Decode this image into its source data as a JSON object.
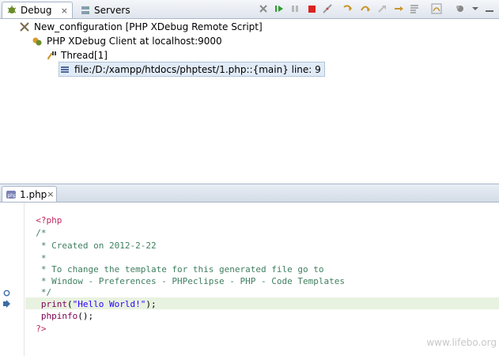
{
  "debug_view": {
    "tab_label": "Debug",
    "tab_close": "×",
    "servers_tab_label": "Servers",
    "toolbar": [
      "remove-launch-icon",
      "resume-icon",
      "suspend-icon",
      "terminate-icon",
      "disconnect-icon",
      "step-into-icon",
      "step-over-icon",
      "step-return-icon",
      "drop-to-frame-icon",
      "use-step-filters-icon",
      "debug-view-menu-icon",
      "view-menu-icon",
      "minimize-icon",
      "maximize-icon"
    ],
    "tree": {
      "launch": "New_configuration [PHP XDebug Remote Script]",
      "client": "PHP XDebug Client at localhost:9000",
      "thread": "Thread[1]",
      "stack_frame": "file:/D:/xampp/htdocs/phptest/1.php::{main} line: 9"
    }
  },
  "editor": {
    "file_tab_label": "1.php",
    "tab_close": "×",
    "code": {
      "l1": "<?php",
      "l2": "/*",
      "l3": " * Created on 2012-2-22",
      "l4": " *",
      "l5": " * To change the template for this generated file go to",
      "l6": " * Window - Preferences - PHPeclipse - PHP - Code Templates",
      "l7": " */",
      "l8_fn": " print",
      "l8_open": "(",
      "l8_str": "\"Hello World!\"",
      "l8_close": ");",
      "l9_fn": " phpinfo",
      "l9_rest": "();",
      "l10": "?>"
    },
    "current_line": 9
  },
  "watermark": "www.lifebo.org",
  "colors": {
    "php_tag": "#c0285e",
    "comment": "#3f7f5f",
    "keyword": "#7f0055",
    "string": "#2a00ff",
    "current_line_bg": "#e8f2e0",
    "selection_bg": "#e1ebf7"
  }
}
